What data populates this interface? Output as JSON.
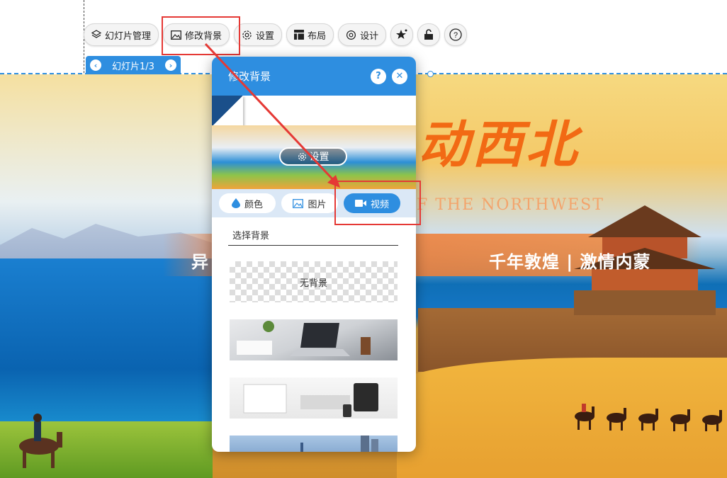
{
  "toolbar": {
    "items": [
      {
        "label": "幻灯片管理",
        "icon": "layers-icon"
      },
      {
        "label": "修改背景",
        "icon": "image-icon"
      },
      {
        "label": "设置",
        "icon": "gear-icon"
      },
      {
        "label": "布局",
        "icon": "layout-icon"
      },
      {
        "label": "设计",
        "icon": "design-icon"
      },
      {
        "label": "",
        "icon": "star-sparkle-icon"
      },
      {
        "label": "",
        "icon": "unlock-icon"
      },
      {
        "label": "",
        "icon": "help-icon"
      }
    ]
  },
  "slide_tab": {
    "label": "幻灯片1/3",
    "prev": "‹",
    "next": "›"
  },
  "slide": {
    "title": "动西北",
    "subtitle_en": "F THE NORTHWEST",
    "left_text": "异",
    "right_text": "千年敦煌 | 激情内蒙"
  },
  "panel": {
    "title": "修改背景",
    "help": "?",
    "close": "✕",
    "preview_button": "设置",
    "tabs": [
      {
        "label": "颜色",
        "icon": "droplet-icon",
        "active": false
      },
      {
        "label": "图片",
        "icon": "image-icon",
        "active": false
      },
      {
        "label": "视频",
        "icon": "video-camera-icon",
        "active": true
      }
    ],
    "section_label": "选择背景",
    "backgrounds": [
      {
        "label": "无背景"
      },
      {
        "label": ""
      },
      {
        "label": ""
      },
      {
        "label": ""
      }
    ]
  },
  "colors": {
    "accent": "#2e8ee0",
    "highlight": "#e53935",
    "title_orange": "#f26a14"
  }
}
